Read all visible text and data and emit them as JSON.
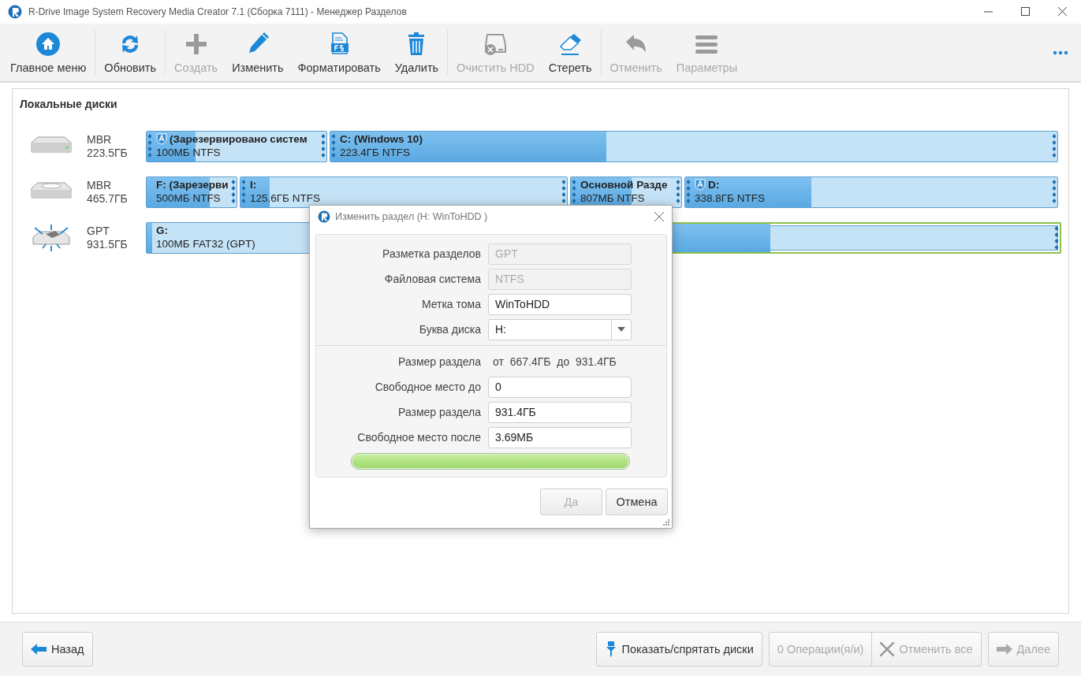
{
  "window": {
    "title": "R-Drive Image System Recovery Media Creator 7.1 (Сборка 7111) - Менеджер Разделов"
  },
  "toolbar": [
    {
      "label": "Главное меню",
      "disabled": false
    },
    {
      "label": "Обновить",
      "disabled": false
    },
    {
      "label": "Создать",
      "disabled": true
    },
    {
      "label": "Изменить",
      "disabled": false
    },
    {
      "label": "Форматировать",
      "disabled": false
    },
    {
      "label": "Удалить",
      "disabled": false
    },
    {
      "label": "Очистить HDD",
      "disabled": true
    },
    {
      "label": "Стереть",
      "disabled": false
    },
    {
      "label": "Отменить",
      "disabled": true
    },
    {
      "label": "Параметры",
      "disabled": true
    }
  ],
  "panel": {
    "title": "Локальные диски"
  },
  "disks": [
    {
      "style": "MBR",
      "size": "223.5ГБ",
      "partitions": [
        {
          "label": "(Зарезервировано систем",
          "info": "100МБ NTFS",
          "active": true,
          "selected": false,
          "level": 0.27
        },
        {
          "label": "C: (Windows 10)",
          "info": "223.4ГБ NTFS",
          "active": false,
          "selected": false,
          "level": 0.38
        }
      ]
    },
    {
      "style": "MBR",
      "size": "465.7ГБ",
      "partitions": [
        {
          "label": "F: (Зарезерви",
          "info": "500МБ NTFS",
          "active": false,
          "selected": false,
          "level": 0.7
        },
        {
          "label": "I:",
          "info": "125.6ГБ NTFS",
          "active": false,
          "selected": false,
          "level": 0.09
        },
        {
          "label": "Основной Разде",
          "info": "807МБ NTFS",
          "active": false,
          "selected": false,
          "level": 0.55
        },
        {
          "label": "D:",
          "info": "338.8ГБ NTFS",
          "active": true,
          "selected": false,
          "level": 0.34
        }
      ]
    },
    {
      "style": "GPT",
      "size": "931.5ГБ",
      "partitions": [
        {
          "label": "G:",
          "info": "100МБ FAT32 (GPT)",
          "active": false,
          "selected": false,
          "level": 0.03
        },
        {
          "active": false,
          "selected": true,
          "level": 0.6
        }
      ]
    }
  ],
  "dialog": {
    "title": "Изменить раздел (H: WinToHDD )",
    "fields": [
      {
        "kind": "readonly",
        "label": "Разметка разделов",
        "value": "GPT"
      },
      {
        "kind": "readonly",
        "label": "Файловая система",
        "value": "NTFS"
      },
      {
        "kind": "input",
        "label": "Метка тома",
        "value": "WinToHDD"
      },
      {
        "kind": "select",
        "label": "Буква диска",
        "value": "H:"
      },
      {
        "kind": "divider"
      },
      {
        "kind": "range",
        "label": "Размер раздела",
        "value": "от  667.4ГБ  до  931.4ГБ"
      },
      {
        "kind": "input",
        "label": "Свободное место до",
        "value": "0"
      },
      {
        "kind": "input",
        "label": "Размер раздела",
        "value": "931.4ГБ"
      },
      {
        "kind": "input",
        "label": "Свободное место после",
        "value": "3.69МБ"
      }
    ],
    "bar": {
      "level": 1
    },
    "buttons": [
      {
        "label": "Да",
        "disabled": true
      },
      {
        "label": "Отмена",
        "disabled": false
      }
    ]
  },
  "footer": {
    "back": "Назад",
    "toggle": "Показать/спрятать диски",
    "operations": "0 Операции(я/и)",
    "operations_disabled": true,
    "undo_all": "Отменить все",
    "undo_all_disabled": true,
    "next": "Далее",
    "next_disabled": true
  }
}
